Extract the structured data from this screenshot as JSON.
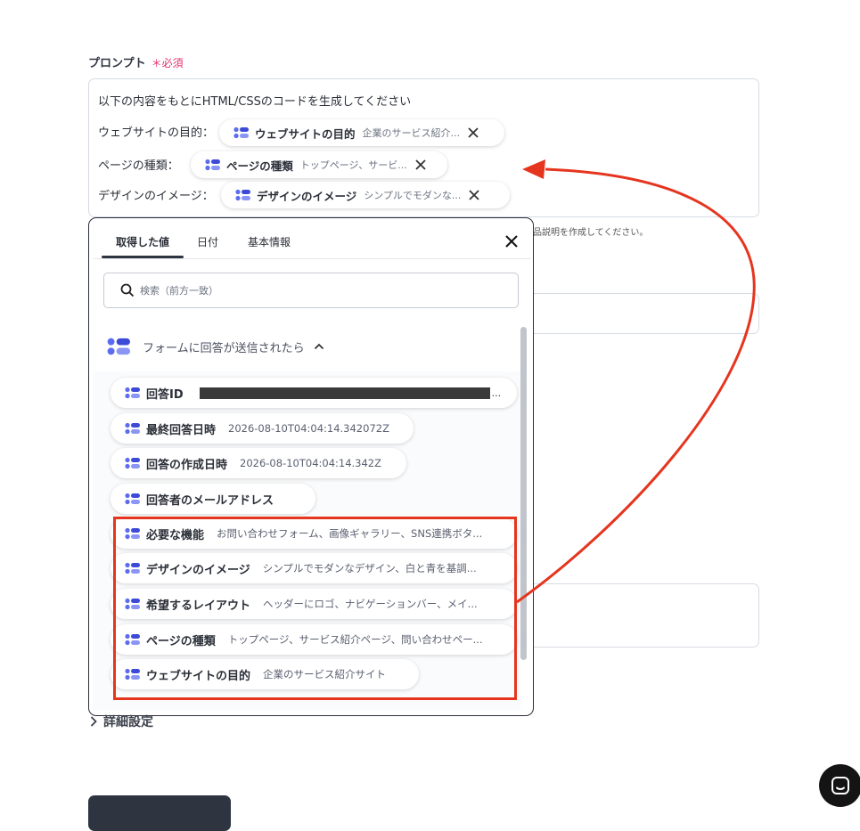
{
  "prompt": {
    "label": "プロンプト",
    "required": "＊必須",
    "line1": "以下の内容をもとにHTML/CSSのコードを生成してください",
    "line2_prefix": "ウェブサイトの目的：",
    "line3_prefix": "ページの種類：",
    "line4_prefix": "デザインのイメージ：",
    "chips": [
      {
        "name": "ウェブサイトの目的",
        "value": "企業のサービス紹介..."
      },
      {
        "name": "ページの種類",
        "value": "トップページ、サービ..."
      },
      {
        "name": "デザインのイメージ",
        "value": "シンプルでモダンな..."
      }
    ]
  },
  "background": {
    "hint": "品説明を作成してください。"
  },
  "popup": {
    "tabs": [
      "取得した値",
      "日付",
      "基本情報"
    ],
    "search_placeholder": "検索（前方一致）",
    "group_label": "フォームに回答が送信されたら",
    "items": [
      {
        "name": "回答ID",
        "value": "",
        "trail": "..."
      },
      {
        "name": "最終回答日時",
        "value": "2026-08-10T04:04:14.342072Z"
      },
      {
        "name": "回答の作成日時",
        "value": "2026-08-10T04:04:14.342Z"
      },
      {
        "name": "回答者のメールアドレス",
        "value": ""
      },
      {
        "name": "必要な機能",
        "value": "お問い合わせフォーム、画像ギャラリー、SNS連携ボタ..."
      },
      {
        "name": "デザインのイメージ",
        "value": "シンプルでモダンなデザイン、白と青を基調..."
      },
      {
        "name": "希望するレイアウト",
        "value": "ヘッダーにロゴ、ナビゲーションバー、メイ..."
      },
      {
        "name": "ページの種類",
        "value": "トップページ、サービス紹介ページ、問い合わせペー..."
      },
      {
        "name": "ウェブサイトの目的",
        "value": "企業のサービス紹介サイト"
      }
    ]
  },
  "detail_settings": "詳細設定",
  "colors": {
    "accent_red": "#e5351f",
    "required_pink": "#e5326b",
    "icon_blue": "#5b6cf0",
    "dark": "#2f3441"
  }
}
